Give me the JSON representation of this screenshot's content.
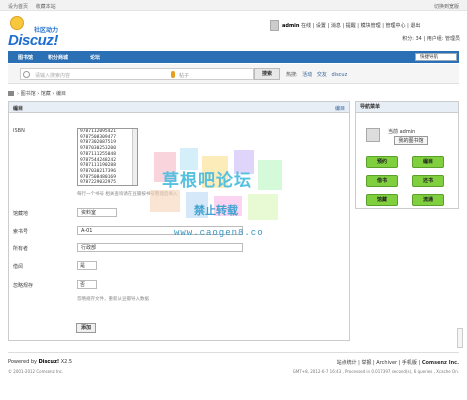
{
  "topbar": {
    "set_home": "设为首页",
    "bookmark": "收藏本站",
    "switch_style": "切换到宽版"
  },
  "logo": {
    "word": "Discuz!",
    "sub": "社区动力"
  },
  "user": {
    "name": "admin",
    "status": "在线",
    "links": [
      "设置",
      "消息",
      "提醒",
      "模块管理",
      "管理中心",
      "退出"
    ],
    "points_label": "积分: 34",
    "group_label": "用户组: 管理员"
  },
  "nav": {
    "items": [
      "图书馆",
      "积分商城",
      "论坛"
    ],
    "quick": "快捷导航"
  },
  "search": {
    "placeholder": "请输入搜索内容",
    "scope": "帖子",
    "button": "搜索",
    "hot_label": "热搜:",
    "hot": [
      "活动",
      "交友",
      "discuz"
    ]
  },
  "breadcrumb": [
    "图书馆",
    "馆藏",
    "编目"
  ],
  "form": {
    "header": "编目",
    "header_right": "编目",
    "isbn_label": "ISBN",
    "isbn_list": [
      "9787112095421",
      "9787508309477",
      "9787302087519",
      "9787030253200",
      "9787111255048",
      "9787544248242",
      "9787111190288",
      "9787030217396",
      "9787508480169",
      "9787229032975"
    ],
    "isbn_hint": "每行一个书号 相关查询请在豆瓣按书号整理后填入",
    "location_label": "馆藏地",
    "location_value": "资料室",
    "callno_label": "索书号",
    "callno_value": "A-01",
    "owner_label": "所有者",
    "owner_value": "行政部",
    "lend_label": "借阅",
    "lend_value": "是",
    "ignore_label": "忽略规存",
    "ignore_value": "否",
    "ignore_hint": "忽略规存文件，重新从豆瓣导入数据",
    "submit": "添加"
  },
  "sidebar": {
    "title": "导航菜单",
    "current_label": "当前 admin",
    "mylib": "我的图书馆",
    "buttons": [
      "预约",
      "编目",
      "借书",
      "还书",
      "馆藏",
      "流通"
    ],
    "btn_color": "#7fcf3f"
  },
  "watermark": {
    "line1": "草根吧论坛",
    "line2": "禁止转载",
    "line3": "www.caogen8.co"
  },
  "footer": {
    "powered_prefix": "Powered by ",
    "product": "Discuz!",
    "version": " X2.5",
    "copyright": "© 2001-2012 Comsenz Inc.",
    "links": "站点统计 | 举报 | Archiver | 手机版 |",
    "company": "Comsenz Inc.",
    "meta": "GMT+8, 2012-6-7 16:43 , Processed in 0.017397 second(s), 6 queries , Xcache On."
  },
  "colors": {
    "nav": "#2b6fb5",
    "accent": "#1f6fd1"
  }
}
